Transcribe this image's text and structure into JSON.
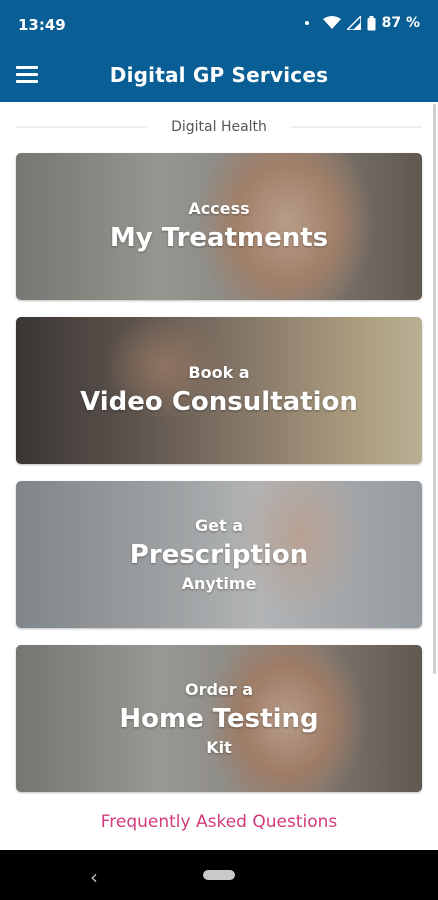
{
  "status_bar": {
    "time": "13:49",
    "battery": "87 %"
  },
  "app_bar": {
    "title": "Digital GP Services"
  },
  "section": {
    "label": "Digital Health"
  },
  "cards": [
    {
      "line1": "Access",
      "line2": "My Treatments",
      "line3": ""
    },
    {
      "line1": "Book a",
      "line2": "Video Consultation",
      "line3": ""
    },
    {
      "line1": "Get a",
      "line2": "Prescription",
      "line3": "Anytime"
    },
    {
      "line1": "Order a",
      "line2": "Home Testing",
      "line3": "Kit"
    }
  ],
  "faq_link": "Frequently Asked Questions",
  "icons": {
    "menu": "hamburger-menu-icon",
    "wifi": "wifi-icon",
    "signal": "signal-icon",
    "battery": "battery-icon",
    "back": "back-icon",
    "home": "home-pill-icon"
  },
  "colors": {
    "primary": "#0a5e96",
    "faq": "#d33a7a"
  }
}
